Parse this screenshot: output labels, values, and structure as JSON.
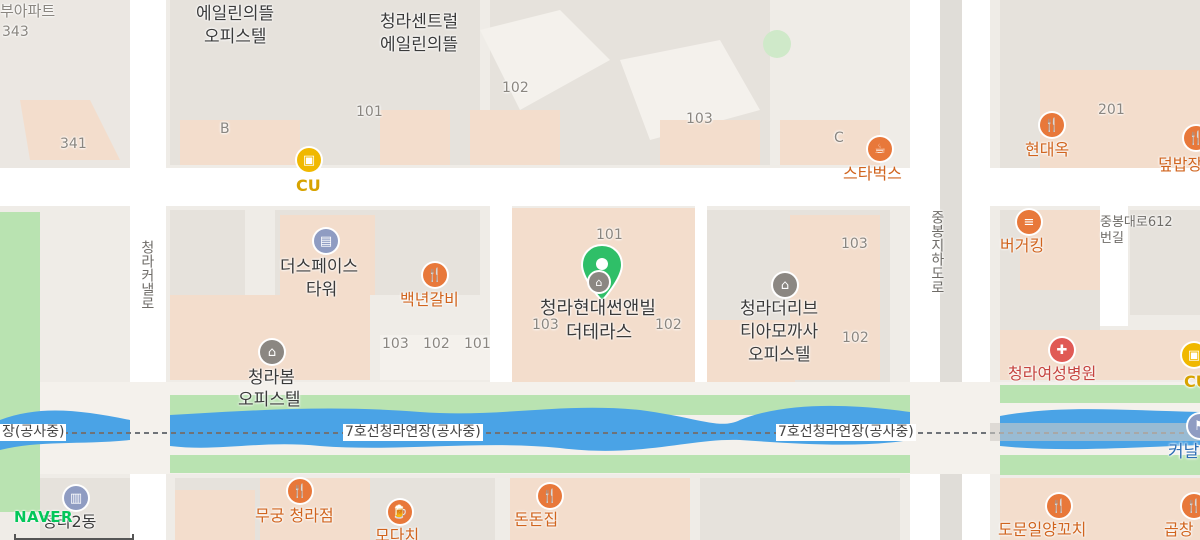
{
  "map": {
    "provider_logo": "NAVER",
    "selected_place": {
      "name_line1": "청라현대썬앤빌",
      "name_line2": "더테라스",
      "marker_icon": "green-location-pin-icon",
      "building_numbers": [
        "101",
        "102",
        "103"
      ]
    },
    "rail": {
      "name": "7호선청라연장(공사중)",
      "left_fragment": "장(공사중)"
    },
    "roads": {
      "cheongnakeo_ro": "청라커낼로",
      "jungbongjiha_ro": "중봉지하도로",
      "jungbongdaero": "중봉대로612번길"
    },
    "pois": {
      "cu_top": "CU",
      "cu_right": "CU",
      "starbucks": "스타벅스",
      "hyundaeok": "현대옥",
      "deopbap_partial": "덮밥장",
      "burger_king": "버거킹",
      "baeknyeon_galbi": "백년갈비",
      "cheongna_womens_hospital": "청라여성병원",
      "mugung": "무궁 청라점",
      "dondonjip": "돈돈집",
      "moodachi": "모다치",
      "domun": "도문일양꼬치",
      "gopchang_partial": "곱창",
      "kanal_partial": "커날"
    },
    "buildings": {
      "apt_partial": "부아파트",
      "apt_partial_num": "343",
      "num_341": "341",
      "eilin_office_1": "에일린의뜰",
      "eilin_office_2": "오피스텔",
      "central_eilin_1": "청라센트럴",
      "central_eilin_2": "에일린의뜰",
      "dspace_1": "더스페이스",
      "dspace_2": "타워",
      "cheongnabom_1": "청라봄",
      "cheongnabom_2": "오피스텔",
      "thelive_1": "청라더리브",
      "thelive_2": "티아모까사",
      "thelive_3": "오피스텔",
      "dong_partial": "청라2동",
      "b_label": "B",
      "c_label": "C",
      "n101a": "101",
      "n102a": "102",
      "n103a": "103",
      "n103b": "103",
      "n102b": "102",
      "n101b": "101",
      "n103c": "103",
      "n102c": "102",
      "n201": "201"
    },
    "colors": {
      "land": "#efece7",
      "building": "#f6e2d2",
      "road": "#ffffff",
      "park": "#a8dfa0",
      "water": "#4aa3e6",
      "pin": "#2fbf68"
    }
  }
}
